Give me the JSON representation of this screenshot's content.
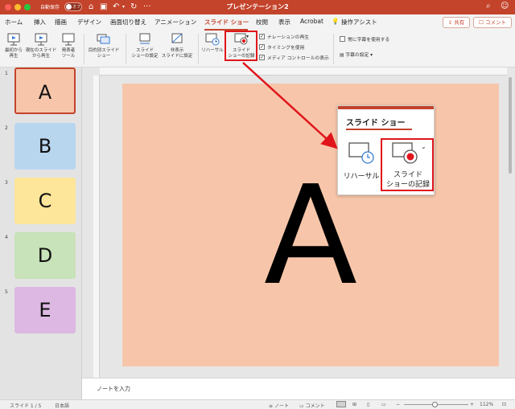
{
  "colors": {
    "brand": "#c4432b",
    "highlight_box": "#e0151b",
    "slide_backgrounds": [
      "#f7c6aa",
      "#b9d6ef",
      "#fde59a",
      "#c8e2b9",
      "#dcb8e3"
    ],
    "record_dot": "#e0151b"
  },
  "titlebar": {
    "autosave_label": "自動保存",
    "autosave_state": "オフ",
    "document_title": "プレゼンテーション2",
    "icons": [
      "home-icon",
      "save-icon",
      "undo-icon",
      "redo-icon",
      "more-icon",
      "search-icon",
      "person-icon"
    ]
  },
  "tabs": [
    "ホーム",
    "挿入",
    "描画",
    "デザイン",
    "画面切り替え",
    "アニメーション",
    "スライド ショー",
    "校閲",
    "表示",
    "Acrobat",
    "操作アシスト"
  ],
  "active_tab": "スライド ショー",
  "share_button": "共有",
  "comment_button": "コメント",
  "ribbon": {
    "from_beginning": "最初から\n再生",
    "from_current": "現在のスライド\nから再生",
    "presenter": "発表者\nツール",
    "custom_show": "目的別スライド\nショー",
    "setup_show": "スライド\nショーの設定",
    "hide_slide": "非表示\nスライドに設定",
    "rehearse": "リハーサル",
    "record": "スライド\nショーの記録",
    "check_narration": "ナレーションの再生",
    "check_timing": "タイミングを使用",
    "check_media": "メディア コントロールの表示",
    "check_subtitles": "常に字幕を使用する",
    "subtitle_settings": "字幕の設定"
  },
  "slides": [
    {
      "number": "1",
      "letter": "A"
    },
    {
      "number": "2",
      "letter": "B"
    },
    {
      "number": "3",
      "letter": "C"
    },
    {
      "number": "4",
      "letter": "D"
    },
    {
      "number": "5",
      "letter": "E"
    }
  ],
  "current_slide_letter": "A",
  "callout": {
    "title": "スライド ショー",
    "rehearse_label": "リハーサル",
    "record_label": "スライド\nショーの記録"
  },
  "notes_placeholder": "ノートを入力",
  "statusbar": {
    "slide_info": "スライド 1 / 5",
    "language": "日本語",
    "notes": "ノート",
    "comments": "コメント",
    "zoom": "112%"
  }
}
